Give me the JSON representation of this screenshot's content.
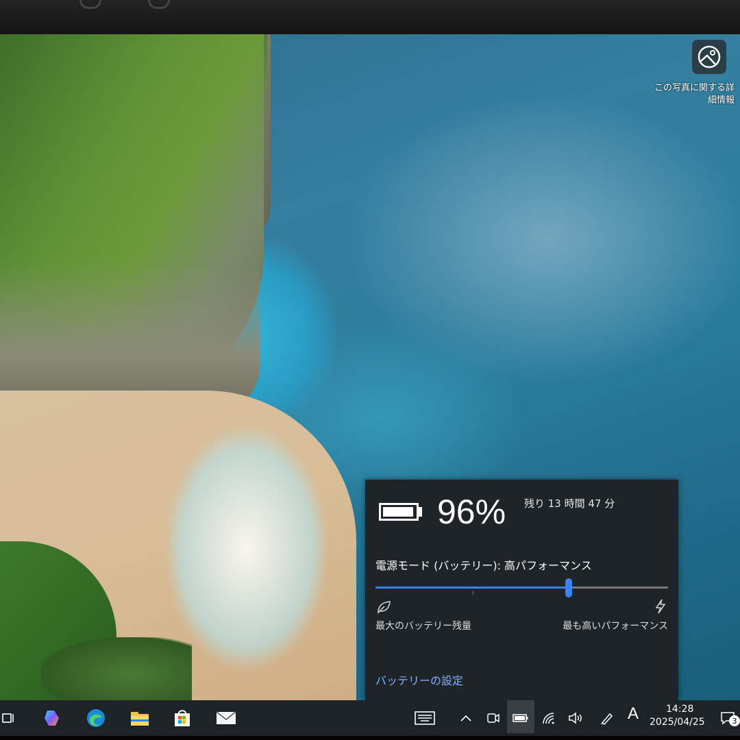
{
  "wallpaper_info": {
    "icon": "camera-info-icon",
    "text": "この写真に関する詳細情報"
  },
  "battery_flyout": {
    "battery_icon": "battery-icon",
    "percent": "96%",
    "percent_value": 96,
    "remaining": "残り 13 時間 47 分",
    "power_mode_label": "電源モード (バッテリー): 高パフォーマンス",
    "slider_value_fraction": 0.66,
    "min_icon": "leaf-icon",
    "max_icon": "lightning-icon",
    "min_label": "最大のバッテリー残量",
    "max_label": "最も高いパフォーマンス",
    "settings_link": "バッテリーの設定"
  },
  "taskbar": {
    "apps": [
      {
        "name": "task-view-icon"
      },
      {
        "name": "copilot-icon"
      },
      {
        "name": "edge-icon"
      },
      {
        "name": "file-explorer-icon"
      },
      {
        "name": "microsoft-store-icon"
      },
      {
        "name": "mail-icon"
      }
    ],
    "tray": {
      "keyboard_icon": "touch-keyboard-icon",
      "overflow_icon": "chevron-up-icon",
      "meet_icon": "meet-now-icon",
      "battery_icon": "battery-icon",
      "network_icon": "wifi-icon",
      "volume_icon": "speaker-icon",
      "pen_icon": "pen-icon",
      "ime_indicator": "A",
      "time": "14:28",
      "date": "2025/04/25",
      "notification_count": "3"
    }
  }
}
